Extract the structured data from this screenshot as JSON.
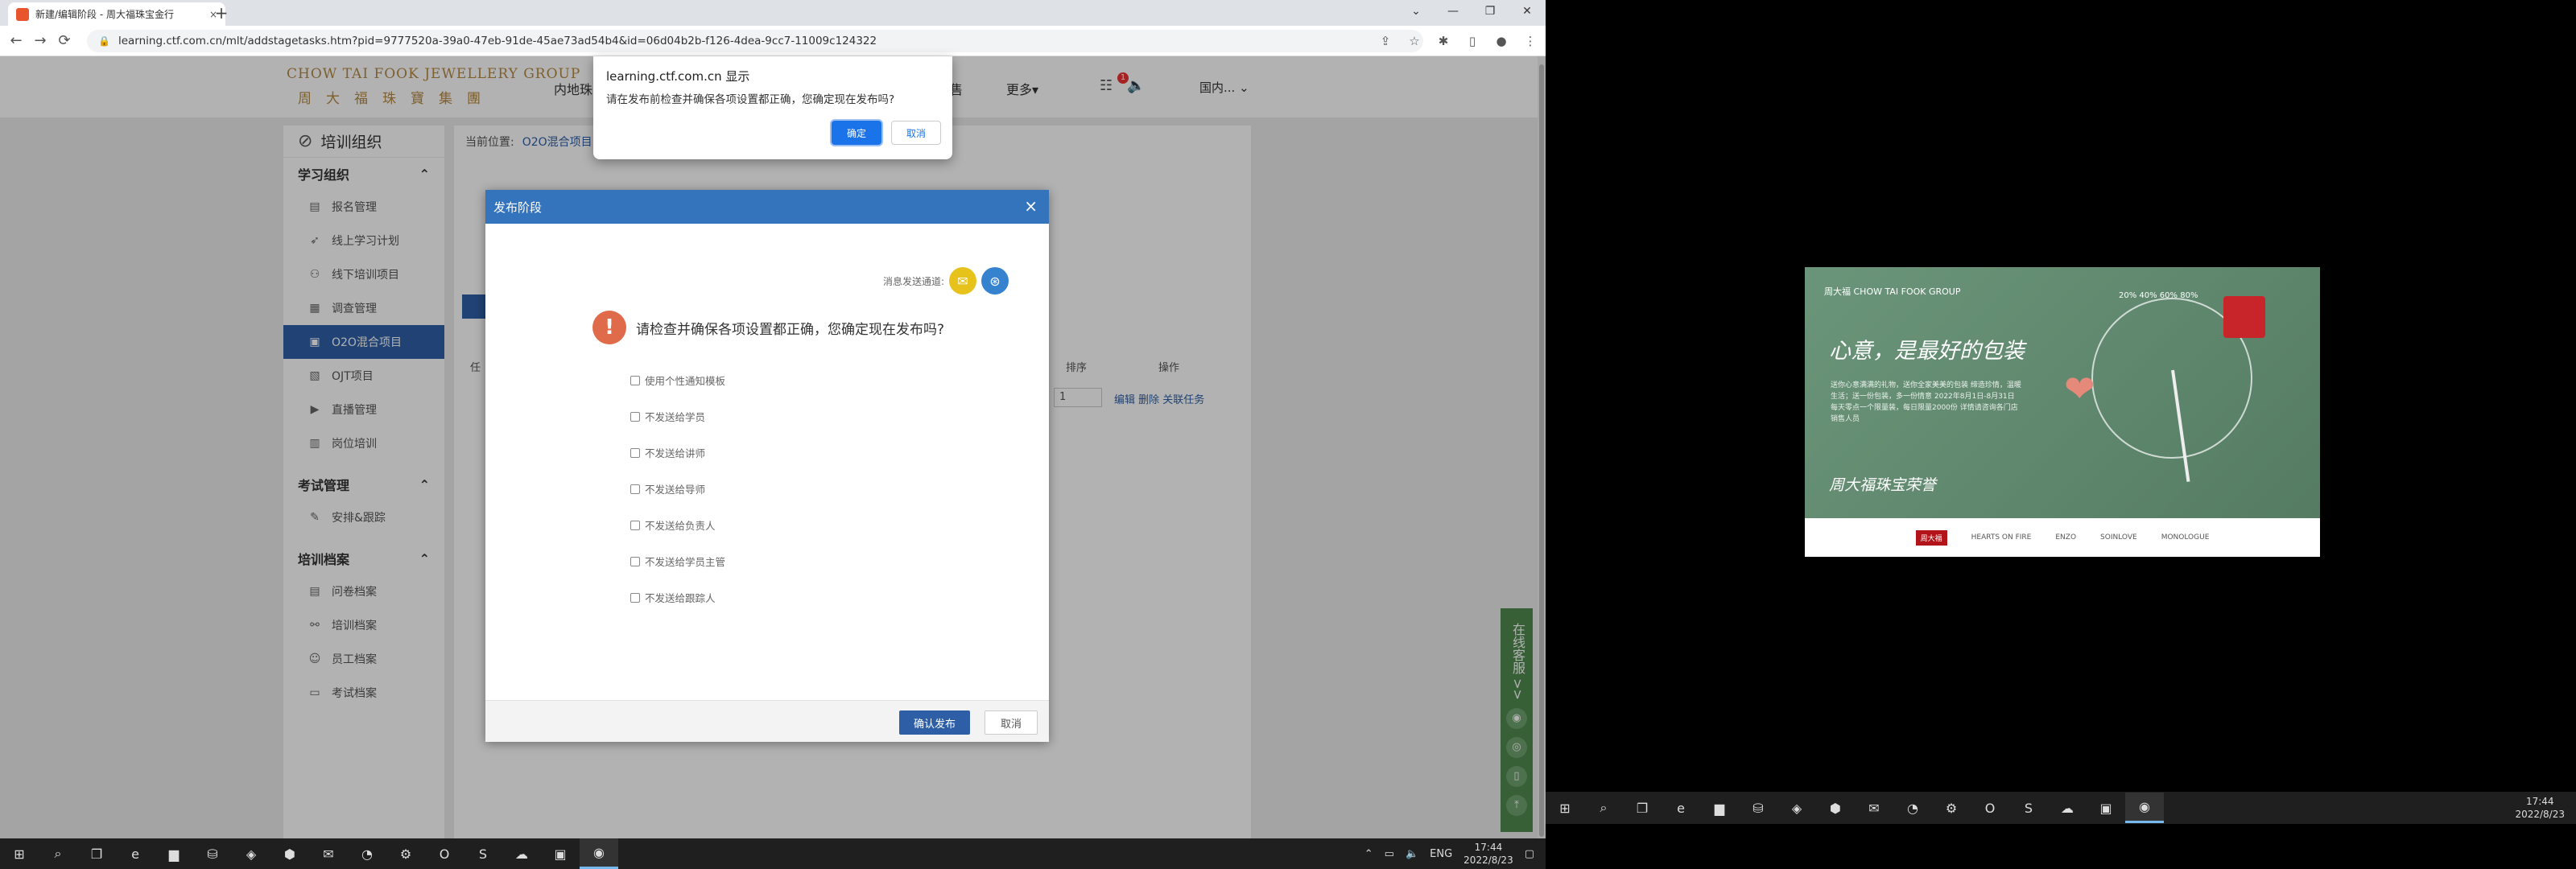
{
  "browser": {
    "tab_title": "新建/编辑阶段 - 周大福珠宝金行",
    "tab_close": "×",
    "new_tab": "+",
    "url": "learning.ctf.com.cn/mlt/addstagetasks.htm?pid=9777520a-39a0-47eb-91de-45ae73ad54b4&id=06d04b2b-f126-4dea-9cc7-11009c124322",
    "window_controls": [
      "⌄",
      "—",
      "❐",
      "✕"
    ]
  },
  "site": {
    "logo_en": "CHOW TAI FOOK JEWELLERY GROUP",
    "logo_cn": "周大福珠寶集團",
    "nav_item_1": "内地珠",
    "nav_item_2": "售",
    "nav_more": "更多▾",
    "notif_count": "1",
    "region": "国内... ⌄"
  },
  "sidebar": {
    "title": "培训组织",
    "groups": [
      {
        "label": "学习组织",
        "items": [
          "报名管理",
          "线上学习计划",
          "线下培训项目",
          "调查管理",
          "O2O混合项目",
          "OJT项目",
          "直播管理",
          "岗位培训"
        ]
      },
      {
        "label": "考试管理",
        "items": [
          "安排&跟踪"
        ]
      },
      {
        "label": "培训档案",
        "items": [
          "问卷档案",
          "培训档案",
          "员工档案",
          "考试档案"
        ]
      }
    ]
  },
  "main": {
    "breadcrumb_label": "当前位置:",
    "breadcrumb_value": "O2O混合项目",
    "table_headers": [
      "任",
      "排序",
      "操作"
    ],
    "row_sort_value": "1",
    "row_actions": "编辑  删除  关联任务"
  },
  "modal": {
    "title": "发布阶段",
    "close": "×",
    "channels_label": "消息发送通道:",
    "warning_icon": "!",
    "warning_text": "请检查并确保各项设置都正确，您确定现在发布吗?",
    "options": [
      "使用个性通知模板",
      "不发送给学员",
      "不发送给讲师",
      "不发送给导师",
      "不发送给负责人",
      "不发送给学员主管",
      "不发送给跟踪人"
    ],
    "confirm_label": "确认发布",
    "cancel_label": "取消"
  },
  "floatbar": {
    "label": "在线客服 >>"
  },
  "alert": {
    "origin": "learning.ctf.com.cn 显示",
    "message": "请在发布前检查并确保各项设置都正确，您确定现在发布吗?",
    "ok_label": "确定",
    "cancel_label": "取消"
  },
  "taskbar1": {
    "lang": "ENG",
    "time": "17:44",
    "date": "2022/8/23"
  },
  "ad": {
    "brand": "周大福 CHOW TAI FOOK GROUP",
    "headline": "心意，是最好的包装",
    "sub": "送你心意满满的礼物，送你全家美美的包装 缔造珍情，温暖生活；送一份包装，多一份情意 2022年8月1日-8月31日 每天零点一个限量装，每日限量2000份 详情请咨询各门店销售人员",
    "sign": "周大福珠宝荣誉",
    "percents": "20%  40%  60%  80%",
    "foot_brands": [
      "周大福",
      "HEARTS ON FIRE",
      "ENZO",
      "SOINLOVE",
      "MONOLOGUE"
    ]
  },
  "taskbar2": {
    "time": "17:44",
    "date": "2022/8/23"
  }
}
